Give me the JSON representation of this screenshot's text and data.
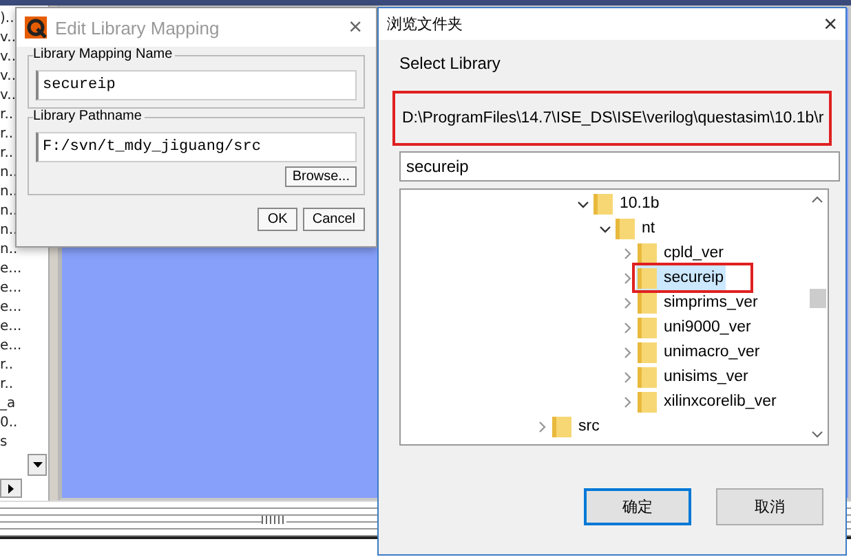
{
  "background_list": {
    "items": [
      ")..",
      "v..",
      "v..",
      "v..",
      "v..",
      "r..",
      "r..",
      "r..",
      "n..",
      "n..",
      "n..",
      "n..",
      "n..",
      "e...",
      "e...",
      "e...",
      "e...",
      "e...",
      "r..",
      "r..",
      "_a",
      "0..",
      "s"
    ]
  },
  "mapping_dialog": {
    "title": "Edit Library Mapping",
    "close": "×",
    "name_group": {
      "label": "Library Mapping Name",
      "value": "secureip"
    },
    "path_group": {
      "label": "Library Pathname",
      "value": "F:/svn/t_mdy_jiguang/src",
      "browse": "Browse..."
    },
    "buttons": [
      "OK",
      "Cancel"
    ]
  },
  "browse_dialog": {
    "title": "浏览文件夹",
    "close": "×",
    "prompt": "Select Library",
    "path": "D:\\ProgramFiles\\14.7\\ISE_DS\\ISE\\verilog\\questasim\\10.1b\\r",
    "folder_field": {
      "value": "secureip"
    },
    "tree": [
      {
        "children": [
          {
            "label": "10.1b",
            "expanded": true,
            "selected": false,
            "children": [
              {
                "label": "nt",
                "expanded": true,
                "selected": false,
                "children": [
                  {
                    "label": "cpld_ver",
                    "expanded": false,
                    "selected": false
                  },
                  {
                    "label": "secureip",
                    "expanded": false,
                    "selected": true
                  },
                  {
                    "label": "simprims_ver",
                    "expanded": false,
                    "selected": false
                  },
                  {
                    "label": "uni9000_ver",
                    "expanded": false,
                    "selected": false
                  },
                  {
                    "label": "unimacro_ver",
                    "expanded": false,
                    "selected": false
                  },
                  {
                    "label": "unisims_ver",
                    "expanded": false,
                    "selected": false
                  },
                  {
                    "label": "xilinxcorelib_ver",
                    "expanded": false,
                    "selected": false
                  }
                ]
              }
            ]
          }
        ]
      },
      {
        "label": "src",
        "expanded": false,
        "selected": false
      }
    ],
    "buttons": [
      "确定",
      "取消"
    ]
  }
}
